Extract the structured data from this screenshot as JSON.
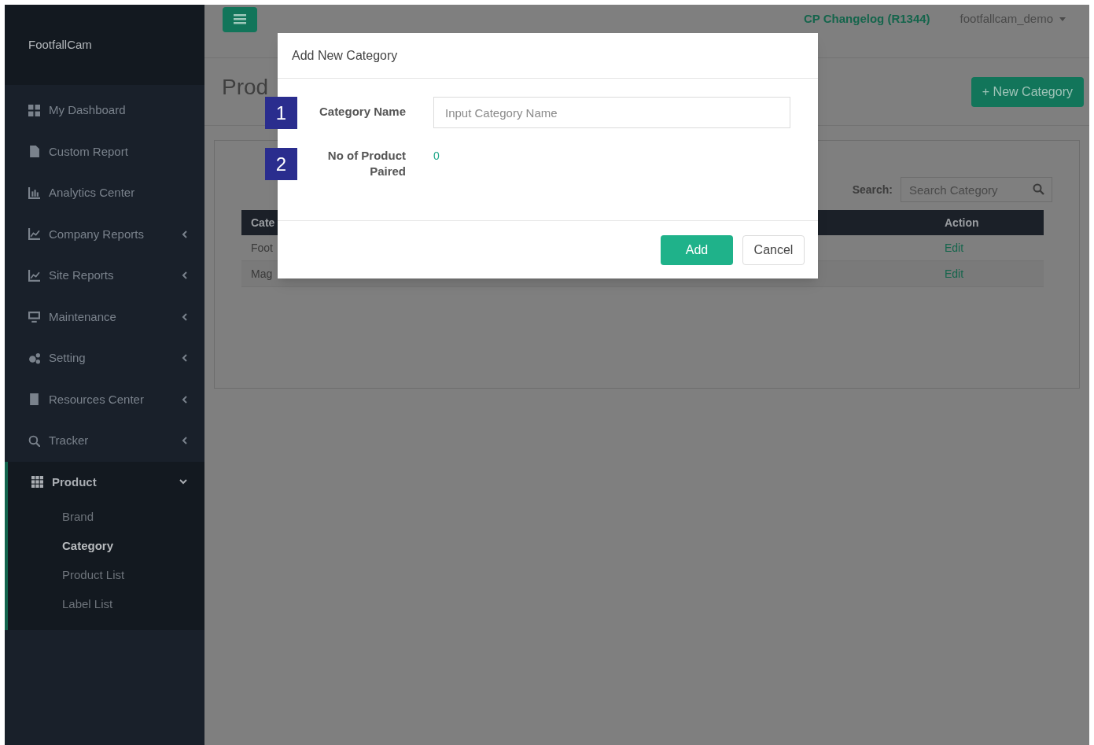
{
  "sidebar": {
    "brand": "FootfallCam",
    "items": [
      {
        "label": "My Dashboard",
        "has_submenu": false,
        "expanded": false
      },
      {
        "label": "Custom Report",
        "has_submenu": false,
        "expanded": false
      },
      {
        "label": "Analytics Center",
        "has_submenu": false,
        "expanded": false
      },
      {
        "label": "Company Reports",
        "has_submenu": true,
        "expanded": false
      },
      {
        "label": "Site Reports",
        "has_submenu": true,
        "expanded": false
      },
      {
        "label": "Maintenance",
        "has_submenu": true,
        "expanded": false
      },
      {
        "label": "Setting",
        "has_submenu": true,
        "expanded": false
      },
      {
        "label": "Resources Center",
        "has_submenu": true,
        "expanded": false
      },
      {
        "label": "Tracker",
        "has_submenu": true,
        "expanded": false
      },
      {
        "label": "Product",
        "has_submenu": true,
        "expanded": true,
        "children": [
          {
            "label": "Brand",
            "selected": false
          },
          {
            "label": "Category",
            "selected": true
          },
          {
            "label": "Product List",
            "selected": false
          },
          {
            "label": "Label List",
            "selected": false
          }
        ]
      }
    ]
  },
  "navbar": {
    "changelog": "CP Changelog (R1344)",
    "user": "footfallcam_demo"
  },
  "page": {
    "title": "Prod",
    "new_button": "+ New Category"
  },
  "search": {
    "label": "Search:",
    "placeholder": "Search Category"
  },
  "table": {
    "columns": [
      "Cate",
      "Action"
    ],
    "rows": [
      {
        "cells": [
          "Foot",
          "Edit"
        ]
      },
      {
        "cells": [
          "Mag",
          "Edit"
        ]
      }
    ]
  },
  "modal": {
    "title": "Add New Category",
    "fields": [
      {
        "marker": "1",
        "label": "Category Name",
        "kind": "input",
        "placeholder": "Input Category Name"
      },
      {
        "marker": "2",
        "label": "No of Product Paired",
        "kind": "value",
        "value": "0"
      }
    ],
    "buttons": [
      {
        "label": "Add",
        "kind": "primary"
      },
      {
        "label": "Cancel",
        "kind": "default"
      }
    ]
  }
}
